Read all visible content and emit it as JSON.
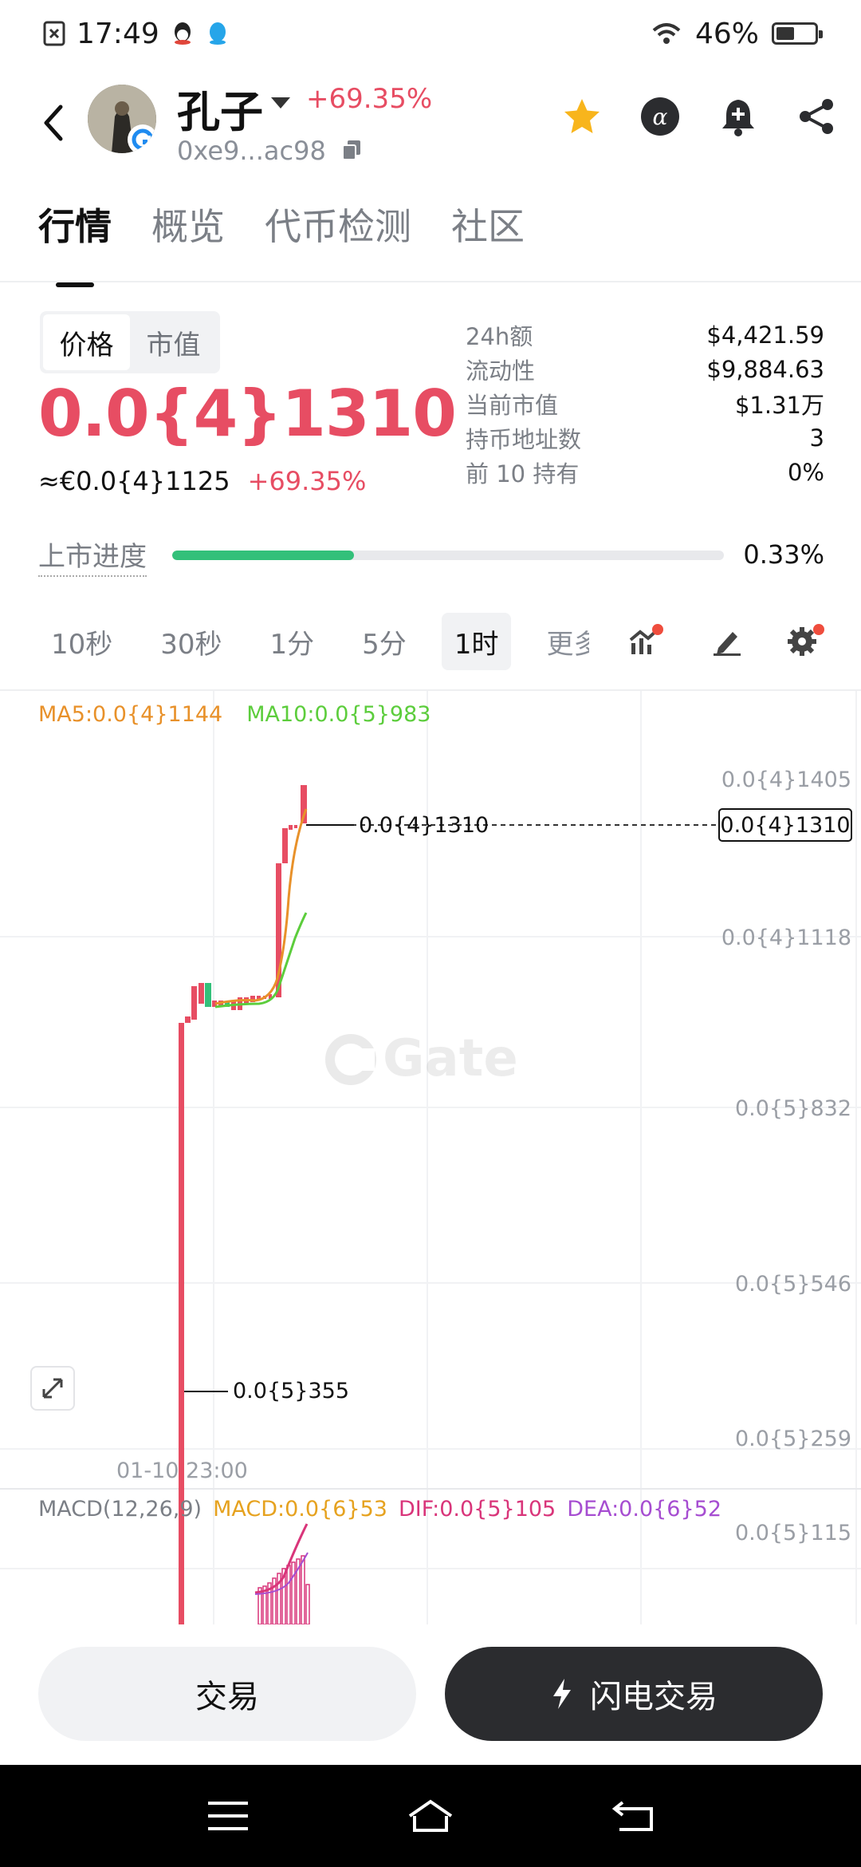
{
  "status_bar": {
    "time": "17:49",
    "battery": "46%"
  },
  "header": {
    "token_name": "孔子",
    "change": "+69.35%",
    "address": "0xe9...ac98"
  },
  "tabs": [
    "行情",
    "概览",
    "代币检测",
    "社区"
  ],
  "price_panel": {
    "toggle": [
      "价格",
      "市值"
    ],
    "price": "0.0{4}1310",
    "eur_price": "≈€0.0{4}1125",
    "change": "+69.35%"
  },
  "stats": [
    {
      "label": "24h额",
      "value": "$4,421.59"
    },
    {
      "label": "流动性",
      "value": "$9,884.63"
    },
    {
      "label": "当前市值",
      "value": "$1.31万"
    },
    {
      "label": "持币地址数",
      "value": "3"
    },
    {
      "label": "前 10 持有",
      "value": "0%"
    }
  ],
  "listing_progress": {
    "label": "上市进度",
    "value": "0.33%",
    "fraction": 0.33
  },
  "intervals": [
    "10秒",
    "30秒",
    "1分",
    "5分",
    "1时",
    "更多"
  ],
  "ma_legend": {
    "ma5": "MA5:0.0{4}1144",
    "ma10": "MA10:0.0{5}983"
  },
  "macd_legend": {
    "title": "MACD(12,26,9)",
    "macd": "MACD:0.0{6}53",
    "dif": "DIF:0.0{5}105",
    "dea": "DEA:0.0{6}52"
  },
  "chart": {
    "y_ticks": [
      "0.0{4}1405",
      "0.0{4}1118",
      "0.0{5}832",
      "0.0{5}546",
      "0.0{5}259"
    ],
    "macd_tick": "0.0{5}115",
    "current_label": "0.0{4}1310",
    "high_label": "0.0{4}1310",
    "low_label": "0.0{5}355",
    "x_label": "01-10 23:00",
    "watermark": "Gate"
  },
  "chart_data": {
    "type": "candlestick",
    "x_label": "01-10 23:00",
    "price_labels": [
      "0.0{4}1405",
      "0.0{4}1118",
      "0.0{5}832",
      "0.0{5}546",
      "0.0{5}259"
    ],
    "last_price": "0.0{4}1310",
    "high": "0.0{4}1310",
    "low": "0.0{5}355",
    "series": [
      {
        "name": "MA5"
      },
      {
        "name": "MA10"
      }
    ]
  },
  "buttons": {
    "trade": "交易",
    "flash_trade": "闪电交易"
  },
  "colors": {
    "up": "#33c07a",
    "down": "#e74d63",
    "ma5": "#e8912a",
    "ma10": "#5ccd3c"
  }
}
